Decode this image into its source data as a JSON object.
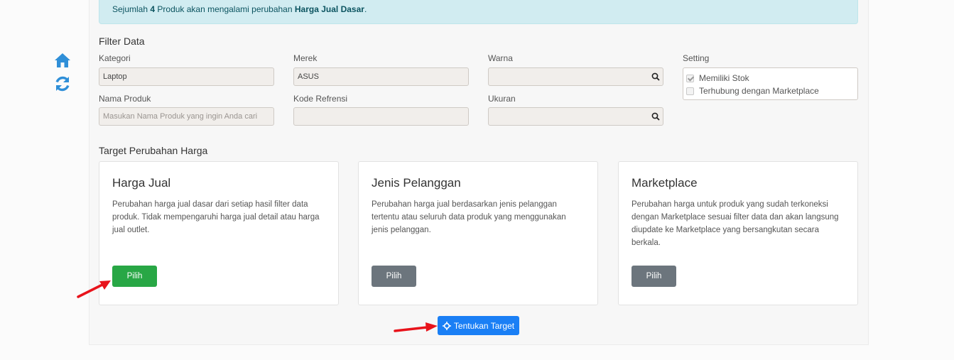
{
  "alert": {
    "prefix": "Sejumlah",
    "count": "4",
    "middle": "Produk akan mengalami perubahan",
    "target": "Harga Jual Dasar",
    "suffix": "."
  },
  "filter": {
    "title": "Filter Data",
    "kategori_label": "Kategori",
    "kategori_value": "Laptop",
    "merek_label": "Merek",
    "merek_value": "ASUS",
    "warna_label": "Warna",
    "warna_value": "",
    "setting_label": "Setting",
    "nama_label": "Nama Produk",
    "nama_placeholder": "Masukan Nama Produk yang ingin Anda cari",
    "kode_label": "Kode Refrensi",
    "kode_value": "",
    "ukuran_label": "Ukuran",
    "ukuran_value": "",
    "settings": [
      {
        "label": "Memiliki Stok",
        "checked": true
      },
      {
        "label": "Terhubung dengan Marketplace",
        "checked": false
      }
    ]
  },
  "target": {
    "title": "Target Perubahan Harga",
    "cards": [
      {
        "title": "Harga Jual",
        "desc": "Perubahan harga jual dasar dari setiap hasil filter data produk. Tidak mempengaruhi harga jual detail atau harga jual outlet.",
        "button": "Pilih"
      },
      {
        "title": "Jenis Pelanggan",
        "desc": "Perubahan harga jual berdasarkan jenis pelanggan tertentu atau seluruh data produk yang menggunakan jenis pelanggan.",
        "button": "Pilih"
      },
      {
        "title": "Marketplace",
        "desc": "Perubahan harga untuk produk yang sudah terkoneksi dengan Marketplace sesuai filter data dan akan langsung diupdate ke Marketplace yang bersangkutan secara berkala.",
        "button": "Pilih"
      }
    ],
    "submit": "Tentukan Target"
  },
  "icons": {
    "home": "home-icon",
    "refresh": "refresh-icon",
    "search": "search-icon",
    "target": "crosshairs-icon"
  },
  "colors": {
    "accent_blue": "#1a7ff5",
    "success": "#28a745",
    "secondary": "#6c757d",
    "info_bg": "#d1ecf1",
    "sidebar_icon": "#2f8fd8",
    "annotation_arrow": "#e8131b"
  }
}
